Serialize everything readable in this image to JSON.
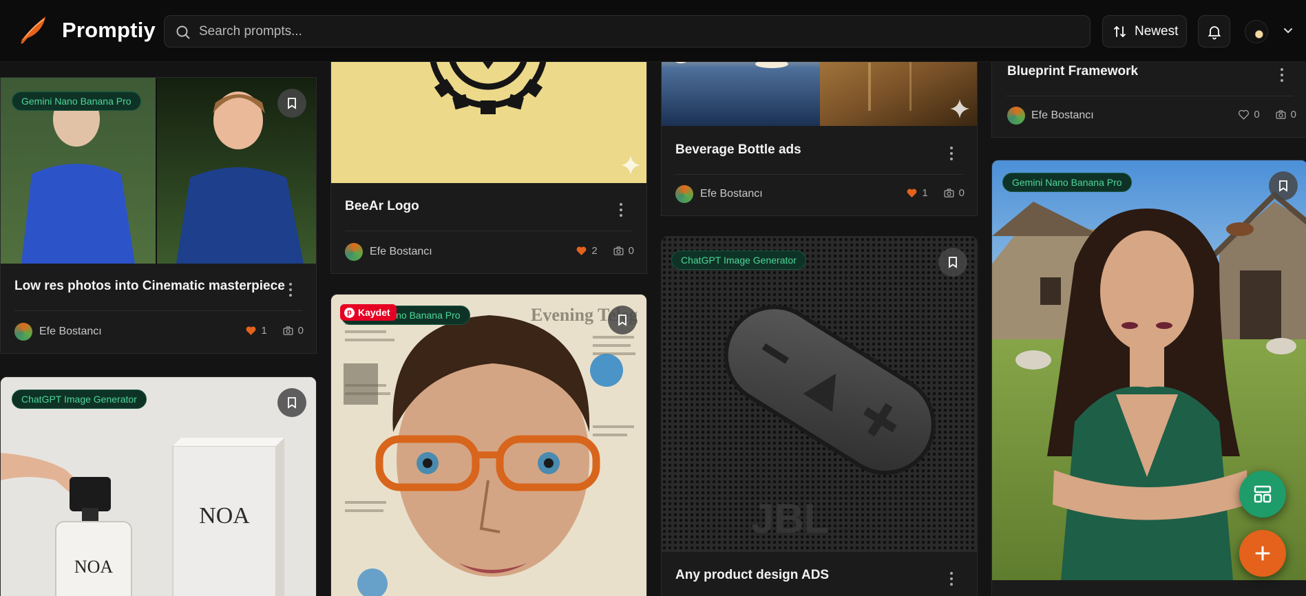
{
  "header": {
    "brand": "Promptiy",
    "search_placeholder": "Search prompts...",
    "sort_label": "Newest"
  },
  "cards": {
    "c1": {
      "badge": "Gemini Nano Banana Pro",
      "title": "Low res photos into Cinematic masterpiece",
      "author": "Efe Bostancı",
      "likes": "1",
      "photos": "0"
    },
    "c2": {
      "title": "BeeAr Logo",
      "author": "Efe Bostancı",
      "likes": "2",
      "photos": "0"
    },
    "c3": {
      "title": "Beverage Bottle ads",
      "author": "Efe Bostancı",
      "likes": "1",
      "photos": "0"
    },
    "c4": {
      "title": "Blueprint Framework",
      "author": "Efe Bostancı",
      "likes": "0",
      "photos": "0"
    },
    "c5": {
      "badge": "ChatGPT Image Generator",
      "bottle_text": "NOA",
      "box_text": "NOA"
    },
    "c6": {
      "badge": "Gemini Nano Banana Pro",
      "pin_label": "Kaydet"
    },
    "c7": {
      "badge": "ChatGPT Image Generator",
      "title": "Any product design ADS"
    },
    "c8": {
      "badge": "Gemini Nano Banana Pro"
    }
  },
  "colors": {
    "accent": "#e4621c",
    "badge_green": "#4fd69a",
    "fab_green": "#1e9c6a",
    "fab_orange": "#e4621c"
  },
  "icons": [
    "logo-feather-icon",
    "search-icon",
    "sort-icon",
    "bell-icon",
    "chevron-down-icon",
    "bookmark-icon",
    "sparkle-icon",
    "heart-icon",
    "camera-icon",
    "layout-icon",
    "plus-icon",
    "pinterest-icon"
  ]
}
